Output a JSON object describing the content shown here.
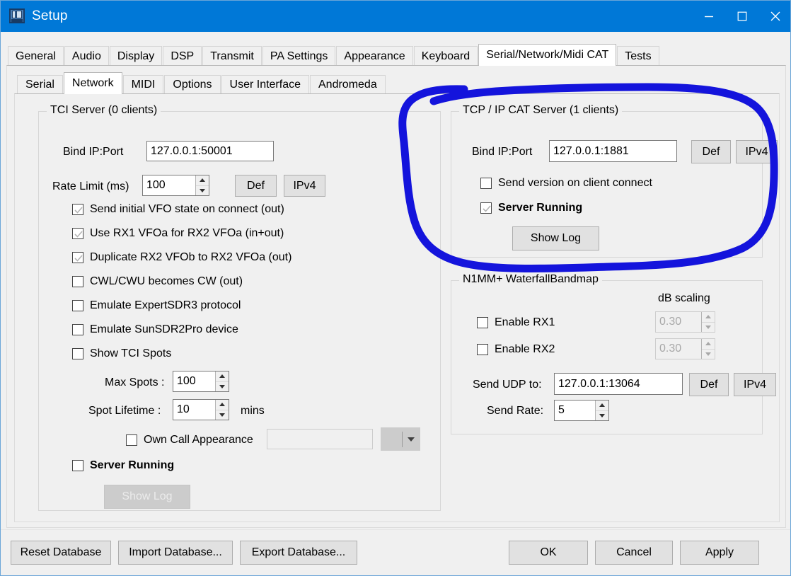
{
  "window": {
    "title": "Setup",
    "icon": "radio-setup-icon",
    "titlebar_color": "#0078d7",
    "controls": [
      {
        "name": "minimize",
        "glyph": "minimize-icon"
      },
      {
        "name": "maximize",
        "glyph": "maximize-icon"
      },
      {
        "name": "close",
        "glyph": "close-icon"
      }
    ]
  },
  "outer_tabs": [
    {
      "label": "General",
      "active": false
    },
    {
      "label": "Audio",
      "active": false
    },
    {
      "label": "Display",
      "active": false
    },
    {
      "label": "DSP",
      "active": false
    },
    {
      "label": "Transmit",
      "active": false
    },
    {
      "label": "PA Settings",
      "active": false
    },
    {
      "label": "Appearance",
      "active": false
    },
    {
      "label": "Keyboard",
      "active": false
    },
    {
      "label": "Serial/Network/Midi CAT",
      "active": true
    },
    {
      "label": "Tests",
      "active": false
    }
  ],
  "inner_tabs": [
    {
      "label": "Serial",
      "active": false
    },
    {
      "label": "Network",
      "active": true
    },
    {
      "label": "MIDI",
      "active": false
    },
    {
      "label": "Options",
      "active": false
    },
    {
      "label": "User Interface",
      "active": false
    },
    {
      "label": "Andromeda",
      "active": false
    }
  ],
  "tci_server": {
    "title": "TCI Server (0 clients)",
    "bind_label": "Bind IP:Port",
    "bind_value": "127.0.0.1:50001",
    "rate_label": "Rate Limit (ms)",
    "rate_value": "100",
    "def_label": "Def",
    "ipv4_label": "IPv4",
    "checkboxes": [
      {
        "label": "Send initial VFO state on connect (out)",
        "checked": true,
        "bold": false
      },
      {
        "label": "Use RX1 VFOa for RX2 VFOa (in+out)",
        "checked": true,
        "bold": false
      },
      {
        "label": "Duplicate RX2 VFOb to RX2 VFOa (out)",
        "checked": true,
        "bold": false
      },
      {
        "label": "CWL/CWU becomes CW (out)",
        "checked": false,
        "bold": false
      },
      {
        "label": "Emulate ExpertSDR3 protocol",
        "checked": false,
        "bold": false
      },
      {
        "label": "Emulate SunSDR2Pro device",
        "checked": false,
        "bold": false
      },
      {
        "label": "Show TCI Spots",
        "checked": false,
        "bold": false
      }
    ],
    "max_spots_label": "Max Spots :",
    "max_spots_value": "100",
    "spot_lifetime_label": "Spot Lifetime :",
    "spot_lifetime_value": "10",
    "mins_label": "mins",
    "own_call_label": "Own Call Appearance",
    "own_call_checked": false,
    "own_call_value": "",
    "server_running_label": "Server Running",
    "server_running_checked": false,
    "show_log_label": "Show Log",
    "show_log_enabled": false
  },
  "tcp_cat_server": {
    "title": "TCP / IP CAT Server (1 clients)",
    "bind_label": "Bind IP:Port",
    "bind_value": "127.0.0.1:1881",
    "def_label": "Def",
    "ipv4_label": "IPv4",
    "send_version_label": "Send version on client connect",
    "send_version_checked": false,
    "server_running_label": "Server Running",
    "server_running_checked": true,
    "show_log_label": "Show Log",
    "show_log_enabled": true
  },
  "n1mm": {
    "title": "N1MM+ WaterfallBandmap",
    "db_scaling_label": "dB scaling",
    "rx1_label": "Enable RX1",
    "rx1_checked": false,
    "rx1_scaling": "0.30",
    "rx2_label": "Enable RX2",
    "rx2_checked": false,
    "rx2_scaling": "0.30",
    "udp_label": "Send UDP to:",
    "udp_value": "127.0.0.1:13064",
    "def_label": "Def",
    "ipv4_label": "IPv4",
    "rate_label": "Send Rate:",
    "rate_value": "5"
  },
  "footer": {
    "left_buttons": [
      {
        "label": "Reset Database"
      },
      {
        "label": "Import Database..."
      },
      {
        "label": "Export Database..."
      }
    ],
    "right_buttons": [
      {
        "label": "OK"
      },
      {
        "label": "Cancel"
      },
      {
        "label": "Apply"
      }
    ]
  },
  "annotation": {
    "shape": "hand-drawn-ellipse",
    "color": "#1414dc",
    "target": "tcp_cat_server"
  }
}
